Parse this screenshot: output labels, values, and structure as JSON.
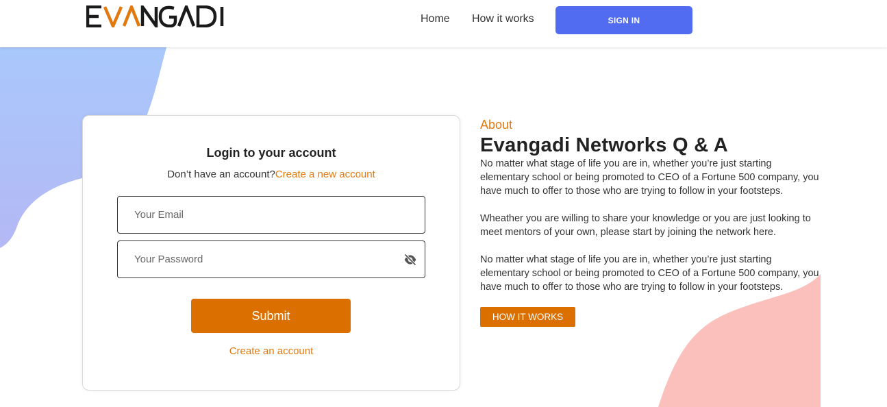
{
  "brand": {
    "logo_text": "EVANGADI",
    "colors": {
      "accent": "#e2790f",
      "button_orange": "#db7000",
      "signin_blue": "#516cf0",
      "logo_dark": "#1a1a1a"
    }
  },
  "nav": {
    "home": "Home",
    "how_it_works": "How it works",
    "sign_in": "SIGN IN"
  },
  "login": {
    "title": "Login to your account",
    "no_account_text": "Don’t have an account?",
    "create_new_link": "Create a new account",
    "email_placeholder": "Your Email",
    "email_value": "",
    "password_placeholder": "Your Password",
    "password_value": "",
    "password_toggle_icon": "eye-slash-icon",
    "submit": "Submit",
    "create_account_link": "Create an account"
  },
  "about": {
    "label": "About",
    "title": "Evangadi Networks Q & A",
    "paragraphs": [
      "No matter what stage of life you are in, whether you’re just starting elementary school or being promoted to CEO of a Fortune 500 company, you have much to offer to those who are trying to follow in your footsteps.",
      "Wheather you are willing to share your knowledge or you are just looking to meet mentors of your own, please start by joining the network here.",
      "No matter what stage of life you are in, whether you’re just starting elementary school or being promoted to CEO of a Fortune 500 company, you have much to offer to those who are trying to follow in your footsteps."
    ],
    "how_it_works_button": "HOW IT WORKS"
  }
}
